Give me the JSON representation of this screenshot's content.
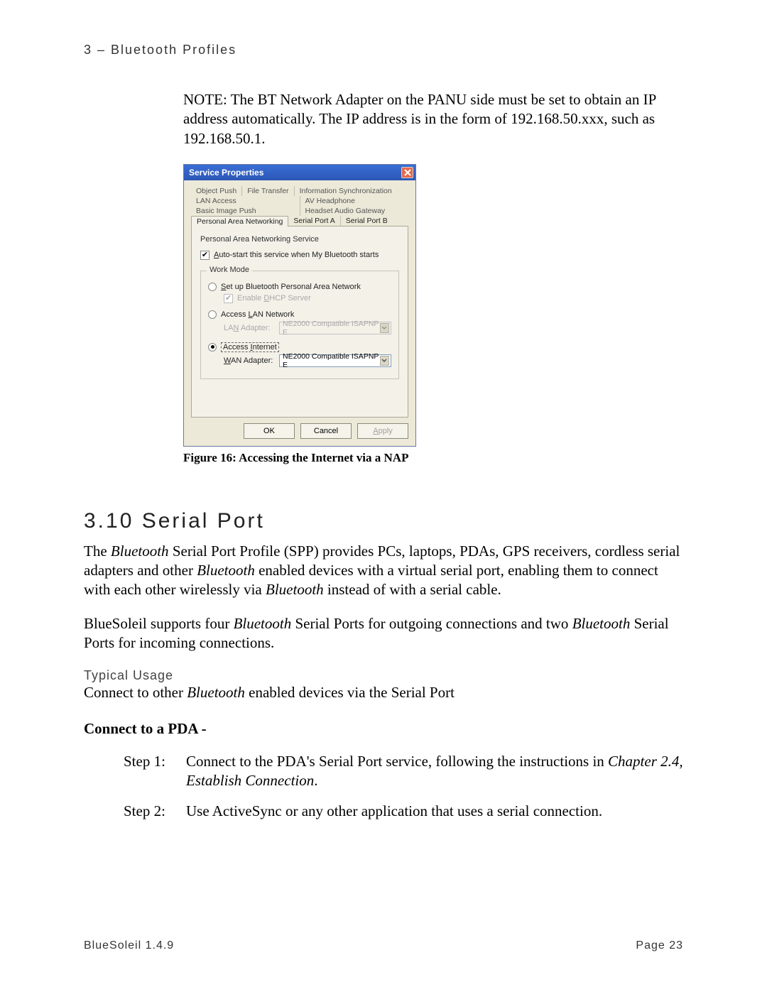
{
  "header": {
    "chapter": "3 – Bluetooth Profiles"
  },
  "note": "NOTE: The BT Network Adapter on the PANU side must be set to obtain an IP address automatically. The IP address is in the form of 192.168.50.xxx, such as 192.168.50.1.",
  "dialog": {
    "title": "Service Properties",
    "tabs_row1": [
      "Object Push",
      "File Transfer",
      "Information Synchronization"
    ],
    "tabs_row2": [
      "LAN Access",
      "AV Headphone"
    ],
    "tabs_row3": [
      "Basic Image Push",
      "Headset Audio Gateway"
    ],
    "tabs_row4": [
      "Personal Area Networking",
      "Serial Port A",
      "Serial Port B"
    ],
    "service_label": "Personal Area Networking Service",
    "autostart_label": "Auto-start this service when My Bluetooth starts",
    "fieldset_legend": "Work Mode",
    "radio_pan": "Set up Bluetooth Personal Area Network",
    "enable_dhcp": "Enable DHCP Server",
    "radio_lan": "Access LAN Network",
    "lan_adapter_label": "LAN Adapter:",
    "lan_adapter_value": "NE2000 Compatible ISAPNP E",
    "radio_internet": "Access Internet",
    "wan_adapter_label": "WAN Adapter:",
    "wan_adapter_value": "NE2000 Compatible ISAPNP E",
    "buttons": {
      "ok": "OK",
      "cancel": "Cancel",
      "apply": "Apply"
    }
  },
  "figure_caption": "Figure 16: Accessing the Internet via a NAP",
  "section": {
    "heading": "3.10 Serial Port",
    "para1_a": "The ",
    "para1_b": "Bluetooth",
    "para1_c": " Serial Port Profile (SPP) provides PCs, laptops, PDAs, GPS receivers, cordless serial adapters and other ",
    "para1_d": "Bluetooth",
    "para1_e": " enabled devices with a virtual serial port, enabling them to connect with each other wirelessly via ",
    "para1_f": "Bluetooth",
    "para1_g": " instead of with a serial cable.",
    "para2_a": "BlueSoleil supports four ",
    "para2_b": "Bluetooth",
    "para2_c": " Serial Ports for outgoing connections and two ",
    "para2_d": "Bluetooth",
    "para2_e": " Serial Ports for incoming connections.",
    "typical_usage_heading": "Typical Usage",
    "typical_usage_a": "Connect to other ",
    "typical_usage_b": "Bluetooth",
    "typical_usage_c": " enabled devices via the Serial Port",
    "connect_pda_heading": "Connect to a PDA -",
    "step1_label": "Step 1:",
    "step1_a": "Connect to the PDA's Serial Port service, following the instructions in ",
    "step1_b": "Chapter 2.4, Establish Connection",
    "step1_c": ".",
    "step2_label": "Step 2:",
    "step2": "Use ActiveSync or any other application that uses a serial connection."
  },
  "footer": {
    "left": "BlueSoleil 1.4.9",
    "right": "Page 23"
  }
}
